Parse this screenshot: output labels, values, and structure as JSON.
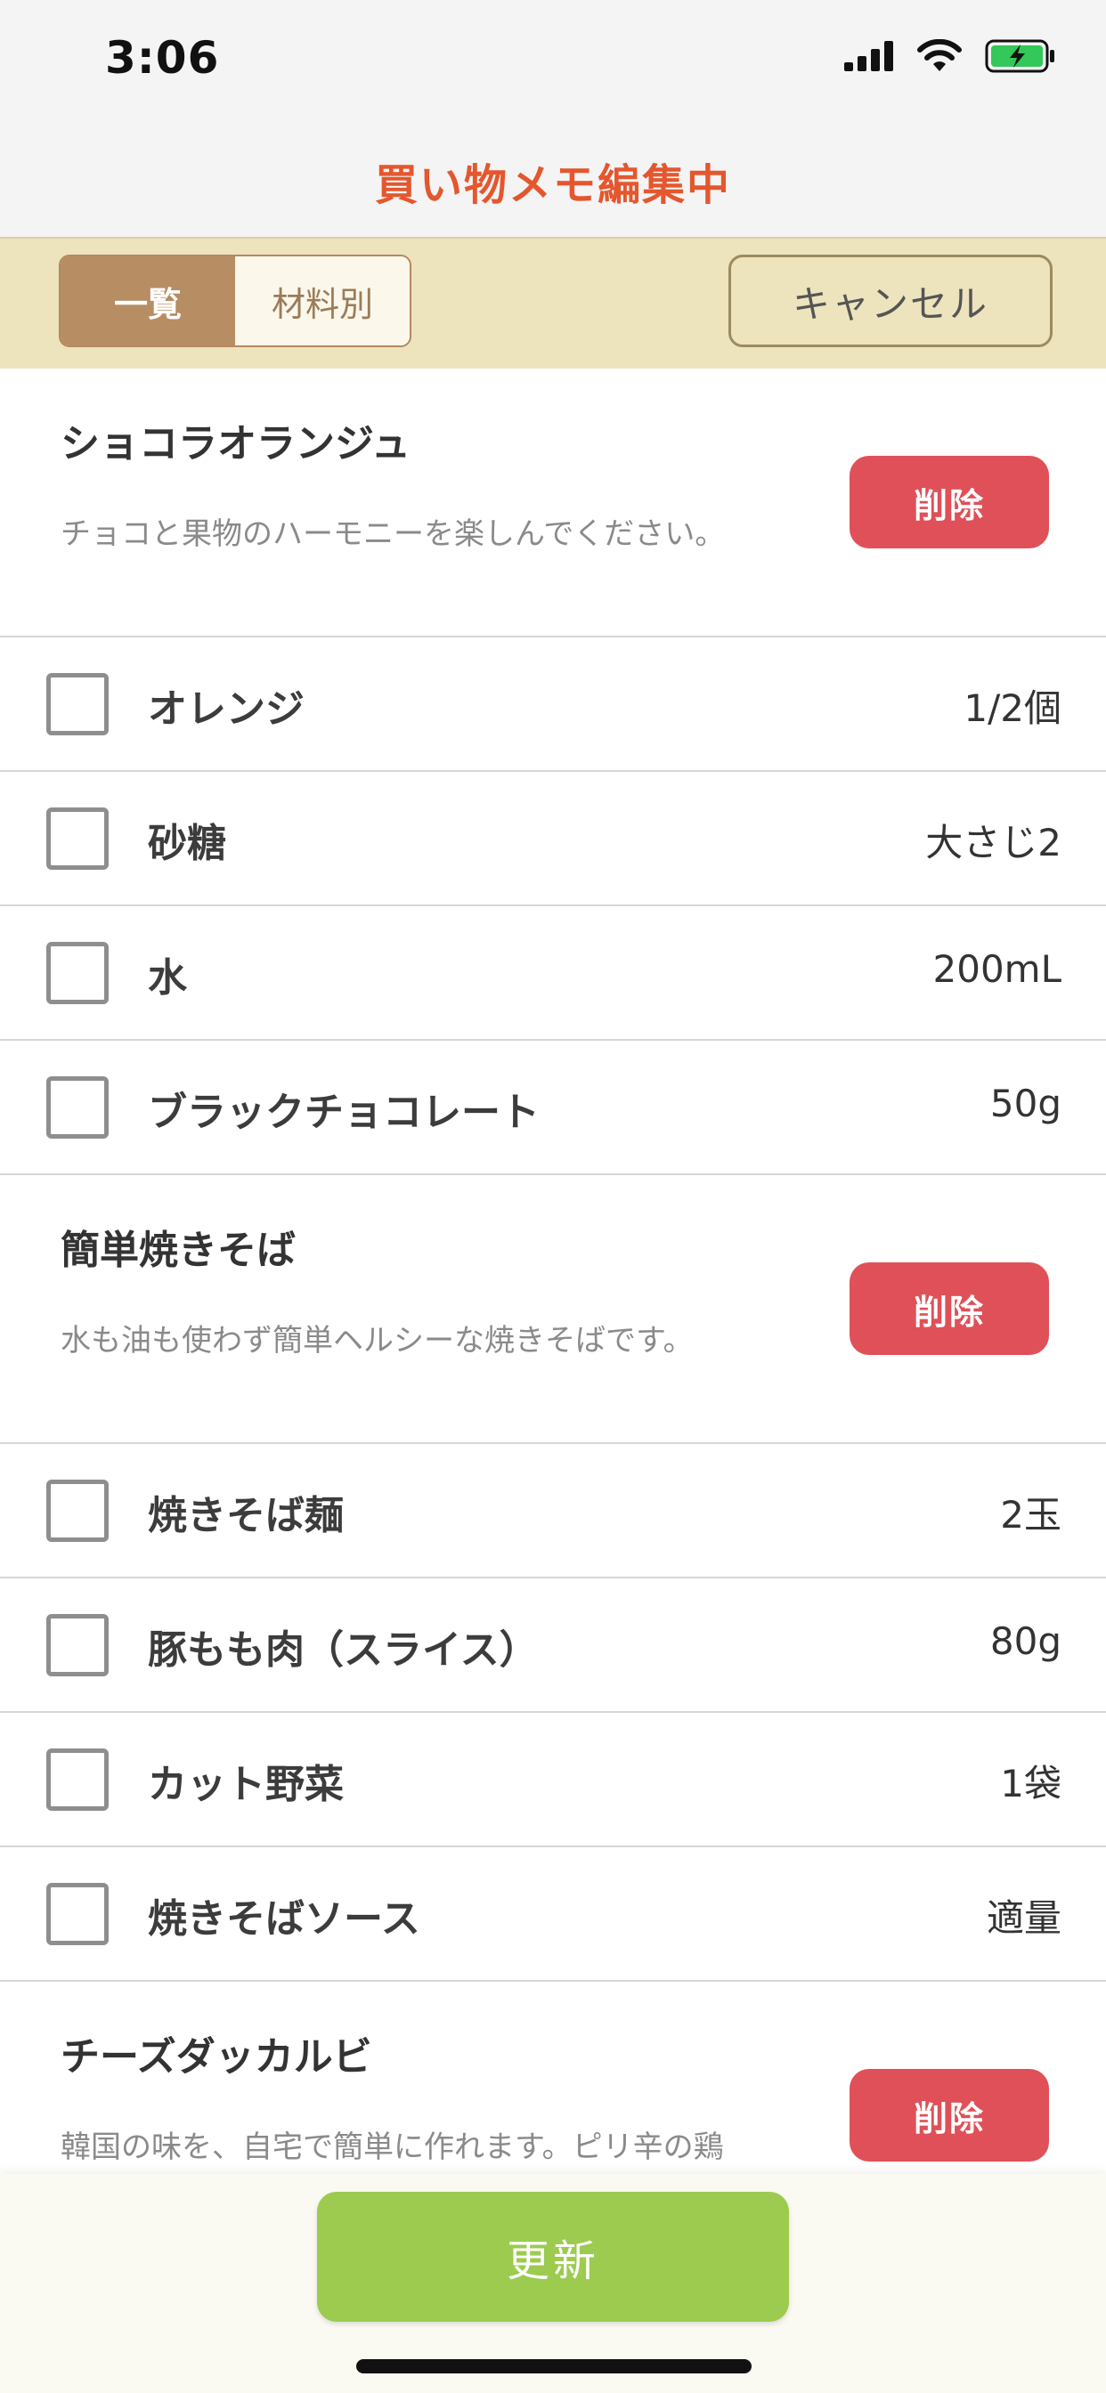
{
  "status_bar": {
    "time": "3:06",
    "icons": [
      "signal-icon",
      "wifi-icon",
      "battery-charging-icon"
    ],
    "battery_color": "#34c759"
  },
  "nav": {
    "title": "買い物メモ編集中",
    "title_color": "#e4572e"
  },
  "toolbar": {
    "segments": [
      {
        "label": "一覧",
        "active": true
      },
      {
        "label": "材料別",
        "active": false
      }
    ],
    "cancel_label": "キャンセル"
  },
  "recipes": [
    {
      "title": "ショコラオランジュ",
      "description": "チョコと果物のハーモニーを楽しんでください。",
      "delete_label": "削除",
      "ingredients": [
        {
          "name": "オレンジ",
          "quantity": "1/2個",
          "checked": false
        },
        {
          "name": "砂糖",
          "quantity": "大さじ2",
          "checked": false
        },
        {
          "name": "水",
          "quantity": "200mL",
          "checked": false
        },
        {
          "name": "ブラックチョコレート",
          "quantity": "50g",
          "checked": false
        }
      ]
    },
    {
      "title": "簡単焼きそば",
      "description": "水も油も使わず簡単ヘルシーな焼きそばです。",
      "delete_label": "削除",
      "ingredients": [
        {
          "name": "焼きそば麺",
          "quantity": "2玉",
          "checked": false
        },
        {
          "name": "豚もも肉（スライス）",
          "quantity": "80g",
          "checked": false
        },
        {
          "name": "カット野菜",
          "quantity": "1袋",
          "checked": false
        },
        {
          "name": "焼きそばソース",
          "quantity": "適量",
          "checked": false
        }
      ]
    },
    {
      "title": "チーズダッカルビ",
      "description": "韓国の味を、自宅で簡単に作れます。ピリ辛の鶏",
      "delete_label": "削除",
      "ingredients": []
    }
  ],
  "bottom": {
    "update_label": "更新",
    "update_color": "#9ccb4f",
    "delete_color": "#e05058"
  }
}
